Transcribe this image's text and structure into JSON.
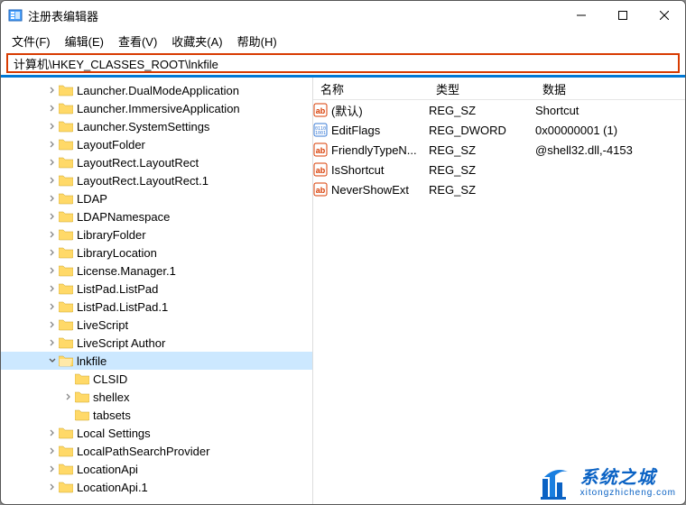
{
  "window": {
    "title": "注册表编辑器"
  },
  "menu": {
    "file": "文件(F)",
    "edit": "编辑(E)",
    "view": "查看(V)",
    "fav": "收藏夹(A)",
    "help": "帮助(H)"
  },
  "address": {
    "value": "计算机\\HKEY_CLASSES_ROOT\\lnkfile"
  },
  "tree": [
    {
      "depth": 1,
      "exp": "closed",
      "label": "Launcher.DualModeApplication"
    },
    {
      "depth": 1,
      "exp": "closed",
      "label": "Launcher.ImmersiveApplication"
    },
    {
      "depth": 1,
      "exp": "closed",
      "label": "Launcher.SystemSettings"
    },
    {
      "depth": 1,
      "exp": "closed",
      "label": "LayoutFolder"
    },
    {
      "depth": 1,
      "exp": "closed",
      "label": "LayoutRect.LayoutRect"
    },
    {
      "depth": 1,
      "exp": "closed",
      "label": "LayoutRect.LayoutRect.1"
    },
    {
      "depth": 1,
      "exp": "closed",
      "label": "LDAP"
    },
    {
      "depth": 1,
      "exp": "closed",
      "label": "LDAPNamespace"
    },
    {
      "depth": 1,
      "exp": "closed",
      "label": "LibraryFolder"
    },
    {
      "depth": 1,
      "exp": "closed",
      "label": "LibraryLocation"
    },
    {
      "depth": 1,
      "exp": "closed",
      "label": "License.Manager.1"
    },
    {
      "depth": 1,
      "exp": "closed",
      "label": "ListPad.ListPad"
    },
    {
      "depth": 1,
      "exp": "closed",
      "label": "ListPad.ListPad.1"
    },
    {
      "depth": 1,
      "exp": "closed",
      "label": "LiveScript"
    },
    {
      "depth": 1,
      "exp": "closed",
      "label": "LiveScript Author"
    },
    {
      "depth": 1,
      "exp": "open",
      "label": "lnkfile",
      "selected": true,
      "open": true
    },
    {
      "depth": 2,
      "exp": "none",
      "label": "CLSID"
    },
    {
      "depth": 2,
      "exp": "closed",
      "label": "shellex"
    },
    {
      "depth": 2,
      "exp": "none",
      "label": "tabsets"
    },
    {
      "depth": 1,
      "exp": "closed",
      "label": "Local Settings"
    },
    {
      "depth": 1,
      "exp": "closed",
      "label": "LocalPathSearchProvider"
    },
    {
      "depth": 1,
      "exp": "closed",
      "label": "LocationApi"
    },
    {
      "depth": 1,
      "exp": "closed",
      "label": "LocationApi.1"
    }
  ],
  "columns": {
    "name": "名称",
    "type": "类型",
    "data": "数据"
  },
  "values": [
    {
      "icon": "str",
      "name": "(默认)",
      "type": "REG_SZ",
      "data": "Shortcut"
    },
    {
      "icon": "bin",
      "name": "EditFlags",
      "type": "REG_DWORD",
      "data": "0x00000001 (1)"
    },
    {
      "icon": "str",
      "name": "FriendlyTypeN...",
      "type": "REG_SZ",
      "data": "@shell32.dll,-4153"
    },
    {
      "icon": "str",
      "name": "IsShortcut",
      "type": "REG_SZ",
      "data": ""
    },
    {
      "icon": "str",
      "name": "NeverShowExt",
      "type": "REG_SZ",
      "data": ""
    }
  ],
  "watermark": {
    "cn": "系统之城",
    "url": "xitongzhicheng.com"
  }
}
